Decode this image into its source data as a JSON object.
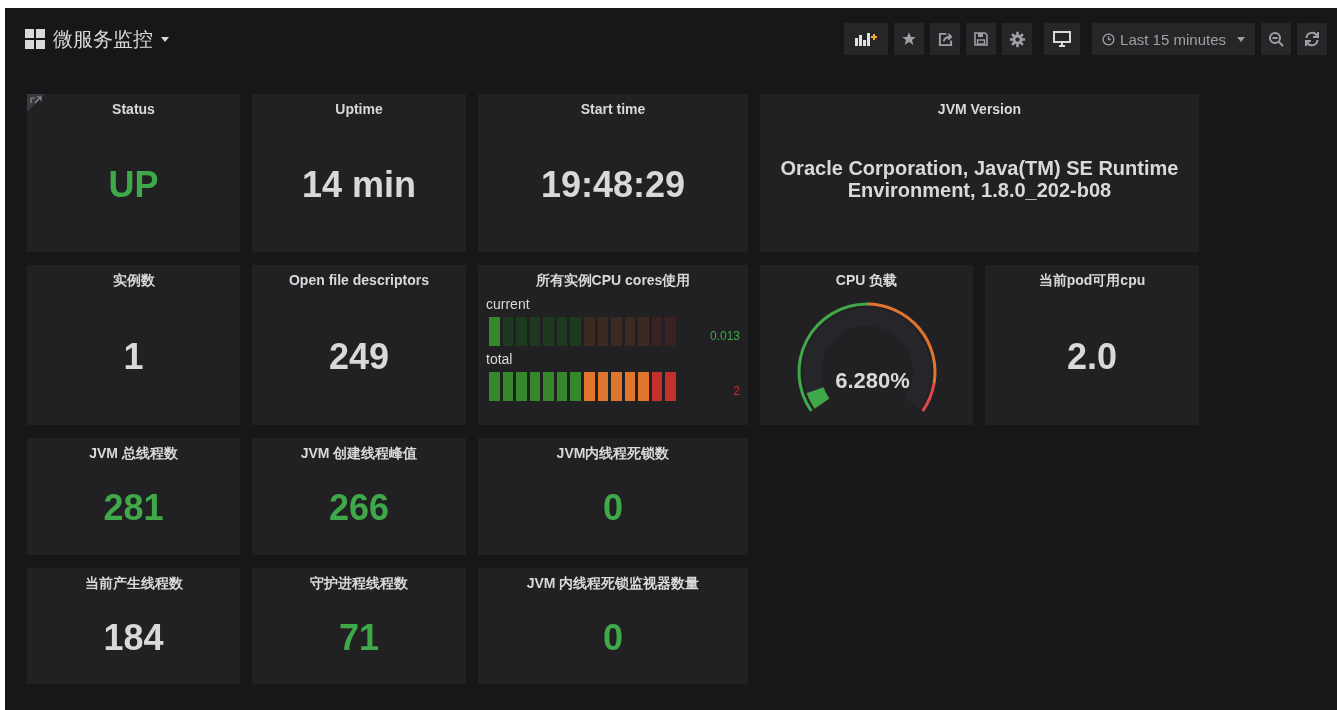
{
  "dashboard": {
    "title": "微服务监控"
  },
  "toolbar": {
    "time_range": "Last 15 minutes"
  },
  "panels": [
    {
      "kind": "stat",
      "title": "Status",
      "value": "UP",
      "color": "#3fa94a"
    },
    {
      "kind": "stat",
      "title": "Uptime",
      "value": "14 min",
      "color": "#d8d9da"
    },
    {
      "kind": "stat",
      "title": "Start time",
      "value": "19:48:29",
      "color": "#d8d9da"
    },
    {
      "kind": "text",
      "title": "JVM Version",
      "value": "Oracle Corporation, Java(TM) SE Runtime Environment, 1.8.0_202-b08",
      "color": "#d8d9da"
    },
    {
      "kind": "stat",
      "title": "实例数",
      "value": "1",
      "color": "#d8d9da"
    },
    {
      "kind": "stat",
      "title": "Open file descriptors",
      "value": "249",
      "color": "#d8d9da"
    },
    {
      "kind": "bargauge",
      "title": "所有实例CPU cores使用",
      "bars": [
        {
          "label": "current",
          "level": 0.07,
          "reading": "0.013",
          "color": "#3fa94a"
        },
        {
          "label": "total",
          "level": 1,
          "reading": "2",
          "color": "#c4302b"
        }
      ]
    },
    {
      "kind": "gauge",
      "title": "CPU 负载",
      "level": 0.0628,
      "reading": "6.280%"
    },
    {
      "kind": "stat",
      "title": "当前pod可用cpu",
      "value": "2.0",
      "color": "#d8d9da"
    },
    {
      "kind": "stat",
      "title": "JVM 总线程数",
      "value": "281",
      "color": "#3fa94a"
    },
    {
      "kind": "stat",
      "title": "JVM 创建线程峰值",
      "value": "266",
      "color": "#3fa94a"
    },
    {
      "kind": "stat",
      "title": "JVM内线程死锁数",
      "value": "0",
      "color": "#3fa94a"
    },
    {
      "kind": "stat",
      "title": "当前产生线程数",
      "value": "184",
      "color": "#d8d9da"
    },
    {
      "kind": "stat",
      "title": "守护进程线程数",
      "value": "71",
      "color": "#3fa94a"
    },
    {
      "kind": "stat",
      "title": "JVM 内线程死锁监视器数量",
      "value": "0",
      "color": "#3fa94a"
    }
  ]
}
